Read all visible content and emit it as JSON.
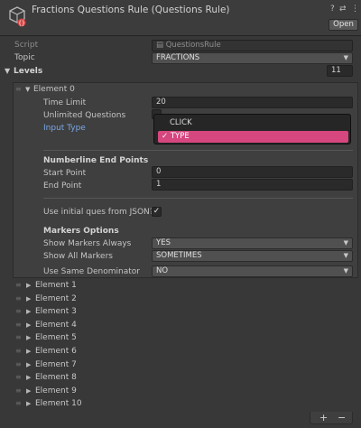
{
  "header": {
    "title": "Fractions Questions Rule (Questions Rule)",
    "open_label": "Open",
    "help_icon": "?",
    "settings_icon": "⇄",
    "menu_icon": "⋮"
  },
  "script_field": {
    "label": "Script",
    "value": "QuestionsRule"
  },
  "topic": {
    "label": "Topic",
    "value": "FRACTIONS"
  },
  "levels": {
    "label": "Levels",
    "count": "11"
  },
  "element0": {
    "label": "Element 0",
    "time_limit": {
      "label": "Time Limit",
      "value": "20"
    },
    "unlimited_questions": {
      "label": "Unlimited Questions"
    },
    "input_type": {
      "label": "Input Type"
    },
    "numberline_header": "Numberline End Points",
    "start_point": {
      "label": "Start Point",
      "value": "0"
    },
    "end_point": {
      "label": "End Point",
      "value": "1"
    },
    "use_initial_json": {
      "label": "Use initial ques from JSON?",
      "checked_glyph": "✓"
    },
    "markers_header": "Markers Options",
    "show_markers_always": {
      "label": "Show Markers Always",
      "value": "YES"
    },
    "show_all_markers": {
      "label": "Show All Markers",
      "value": "SOMETIMES"
    },
    "use_same_denominator": {
      "label": "Use Same Denominator",
      "value": "NO"
    }
  },
  "input_type_popup": {
    "options": [
      "CLICK",
      "TYPE"
    ],
    "selected_index": 1,
    "check_glyph": "✓"
  },
  "elements": [
    "Element 1",
    "Element 2",
    "Element 3",
    "Element 4",
    "Element 5",
    "Element 6",
    "Element 7",
    "Element 8",
    "Element 9",
    "Element 10"
  ],
  "footer": {
    "add": "+",
    "remove": "−"
  },
  "colors": {
    "background": "#383838",
    "accent": "#d6467f",
    "link": "#7aa7e6"
  }
}
